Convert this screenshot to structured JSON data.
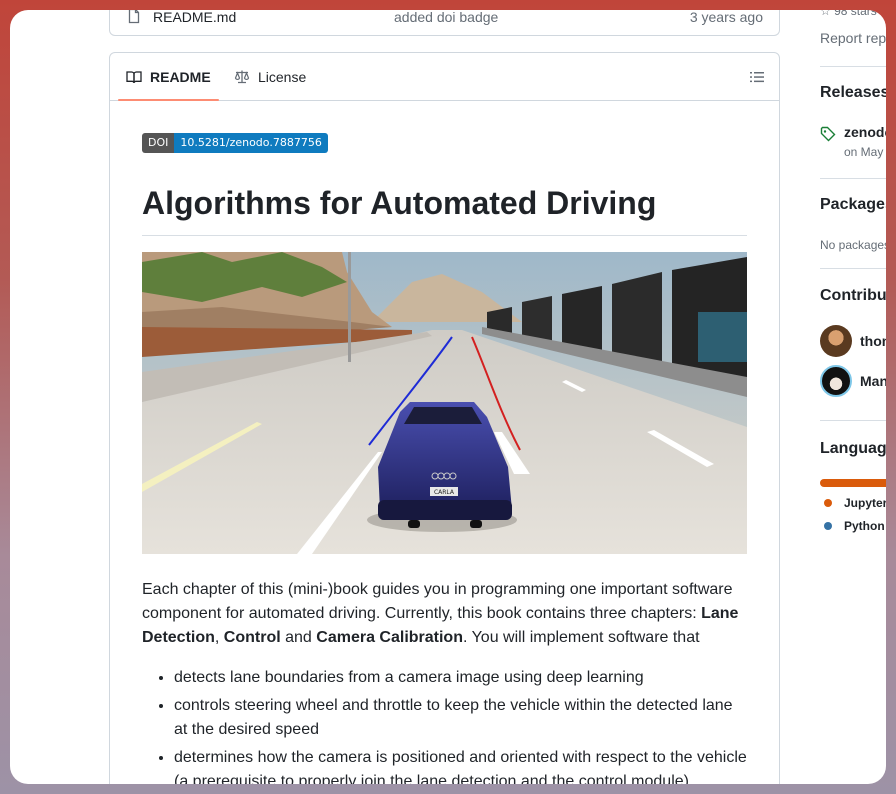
{
  "file_row": {
    "name": "README.md",
    "commit_message": "added doi badge",
    "age": "3 years ago"
  },
  "tabs": {
    "readme": "README",
    "license": "License"
  },
  "readme": {
    "doi_label": "DOI",
    "doi_value": "10.5281/zenodo.7887756",
    "title": "Algorithms for Automated Driving",
    "image_plate": "CARLA",
    "intro_part1": "Each chapter of this (mini-)book guides you in programming one important software component for automated driving. Currently, this book contains three chapters: ",
    "chapter1": "Lane Detection",
    "sep1": ", ",
    "chapter2": "Control",
    "sep2": " and ",
    "chapter3": "Camera Calibration",
    "intro_part2": ". You will implement software that",
    "bullets": [
      "detects lane boundaries from a camera image using deep learning",
      "controls steering wheel and throttle to keep the vehicle within the detected lane at the desired speed",
      "determines how the camera is positioned and oriented with respect to the vehicle (a prerequisite to properly join the lane detection and the control module)"
    ]
  },
  "sidebar": {
    "stars_count": "98 stars",
    "report_link": "Report repository",
    "releases_heading": "Releases",
    "release_name": "zenodo",
    "release_date": "on May",
    "packages_heading": "Packages",
    "packages_text": "No packages published",
    "contributors_heading": "Contributors",
    "contributor1": "thomasfermi",
    "contributor2": "ManuelSchneider",
    "languages_heading": "Languages",
    "lang1": "Jupyter Notebook",
    "lang2": "Python",
    "colors": {
      "jupyter": "#da5b0b",
      "python": "#3572a5"
    }
  }
}
